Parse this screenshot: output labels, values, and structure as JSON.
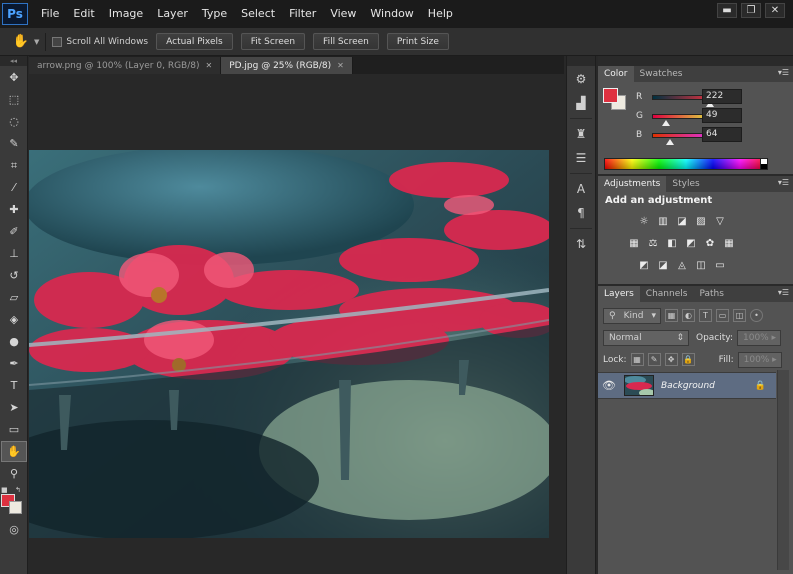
{
  "app": {
    "logo": "Ps"
  },
  "menu": [
    "File",
    "Edit",
    "Image",
    "Layer",
    "Type",
    "Select",
    "Filter",
    "View",
    "Window",
    "Help"
  ],
  "window_controls": [
    "▬",
    "❐",
    "✕"
  ],
  "options_bar": {
    "scroll_all_label": "Scroll All Windows",
    "buttons": [
      "Actual Pixels",
      "Fit Screen",
      "Fill Screen",
      "Print Size"
    ]
  },
  "tabs": [
    {
      "label": "arrow.png @ 100% (Layer 0, RGB/8)",
      "active": false
    },
    {
      "label": "PD.jpg @ 25% (RGB/8)",
      "active": true
    }
  ],
  "tools": [
    {
      "name": "move-tool-icon",
      "glyph": "✥"
    },
    {
      "name": "marquee-tool-icon",
      "glyph": "⬚"
    },
    {
      "name": "lasso-tool-icon",
      "glyph": "◌"
    },
    {
      "name": "quick-select-tool-icon",
      "glyph": "✎"
    },
    {
      "name": "crop-tool-icon",
      "glyph": "⌗"
    },
    {
      "name": "eyedropper-tool-icon",
      "glyph": "⁄"
    },
    {
      "name": "healing-brush-tool-icon",
      "glyph": "✚"
    },
    {
      "name": "brush-tool-icon",
      "glyph": "✐"
    },
    {
      "name": "clone-stamp-tool-icon",
      "glyph": "⊥"
    },
    {
      "name": "history-brush-tool-icon",
      "glyph": "↺"
    },
    {
      "name": "eraser-tool-icon",
      "glyph": "▱"
    },
    {
      "name": "paint-bucket-tool-icon",
      "glyph": "◈"
    },
    {
      "name": "dodge-tool-icon",
      "glyph": "●"
    },
    {
      "name": "pen-tool-icon",
      "glyph": "✒"
    },
    {
      "name": "type-tool-icon",
      "glyph": "T"
    },
    {
      "name": "path-select-tool-icon",
      "glyph": "➤"
    },
    {
      "name": "shape-tool-icon",
      "glyph": "▭"
    },
    {
      "name": "hand-tool-icon",
      "glyph": "✋"
    },
    {
      "name": "zoom-tool-icon",
      "glyph": "⚲"
    }
  ],
  "dock_icons": [
    "⚙",
    "▟",
    "♜",
    "☰",
    "A",
    "¶",
    "⇅"
  ],
  "color_panel": {
    "tabs": [
      "Color",
      "Swatches"
    ],
    "channels": [
      {
        "label": "R",
        "value": "222",
        "fraction": 0.87,
        "gradient": "linear-gradient(to right, #003140, #ff3140)"
      },
      {
        "label": "G",
        "value": "49",
        "fraction": 0.19,
        "gradient": "linear-gradient(to right, #de0040, #deff40)"
      },
      {
        "label": "B",
        "value": "64",
        "fraction": 0.25,
        "gradient": "linear-gradient(to right, #de3100, #de31ff)"
      }
    ],
    "foreground": "#de3140",
    "background": "#eeeae0"
  },
  "adjustments_panel": {
    "tabs": [
      "Adjustments",
      "Styles"
    ],
    "title": "Add an adjustment",
    "rows": [
      [
        "☼",
        "▥",
        "◪",
        "▨",
        "▽"
      ],
      [
        "▦",
        "⚖",
        "◧",
        "◩",
        "✿",
        "▦"
      ],
      [
        "◩",
        "◪",
        "◬",
        "◫",
        "▭"
      ]
    ]
  },
  "layers_panel": {
    "tabs": [
      "Layers",
      "Channels",
      "Paths"
    ],
    "kind_label": "Kind",
    "blend_mode": "Normal",
    "opacity_label": "Opacity:",
    "opacity_value": "100%",
    "lock_label": "Lock:",
    "fill_label": "Fill:",
    "fill_value": "100%",
    "layers": [
      {
        "name": "Background",
        "locked": true,
        "visible": true
      }
    ]
  },
  "colors": {
    "chrome_dark": "#1b1b1b",
    "panel": "#535353",
    "accent_blue": "#4da3ff"
  }
}
